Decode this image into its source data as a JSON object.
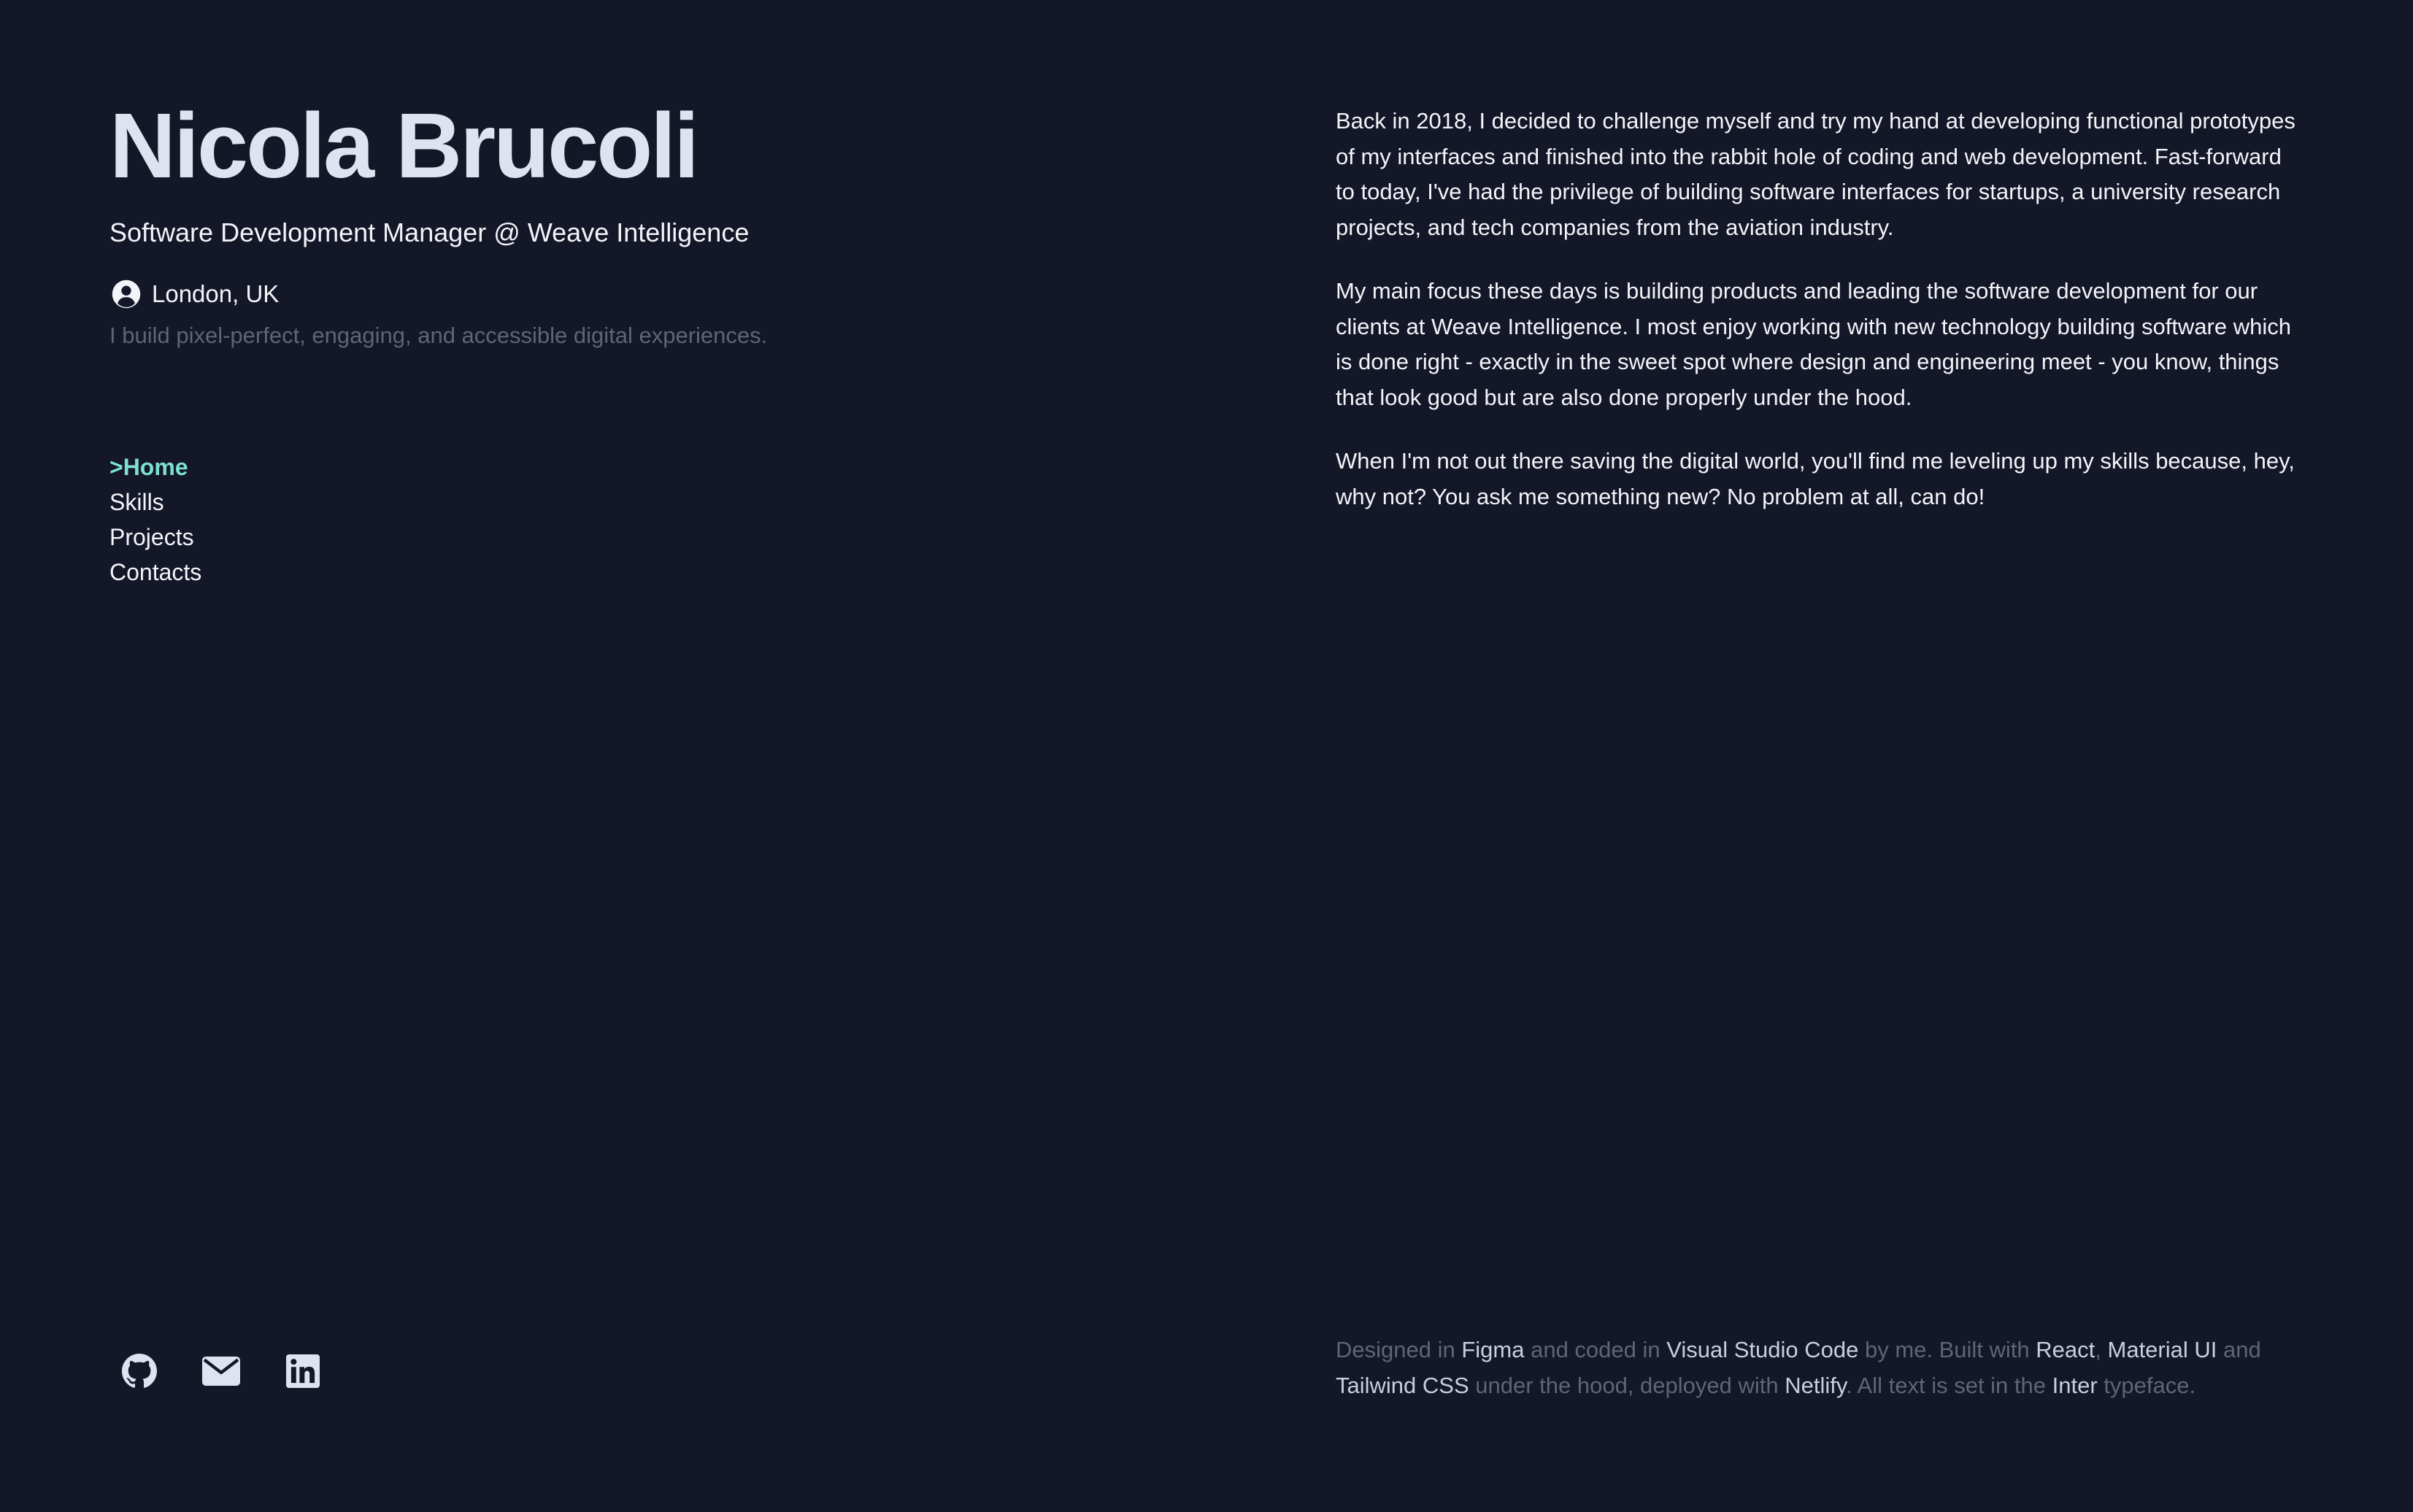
{
  "profile": {
    "name": "Nicola Brucoli",
    "role": "Software Development Manager @ Weave Intelligence",
    "location": "London, UK",
    "tagline": "I build pixel-perfect, engaging, and accessible digital experiences."
  },
  "nav": {
    "items": [
      {
        "label": ">Home",
        "active": true
      },
      {
        "label": "Skills",
        "active": false
      },
      {
        "label": "Projects",
        "active": false
      },
      {
        "label": "Contacts",
        "active": false
      }
    ]
  },
  "socials": {
    "icons": [
      "github-icon",
      "mail-icon",
      "linkedin-icon"
    ]
  },
  "about": {
    "paragraphs": [
      "Back in 2018, I decided to challenge myself and try my hand at developing functional prototypes of my interfaces and finished into the rabbit hole of coding and web development. Fast-forward to today, I've had the privilege of building software interfaces for startups, a university research projects, and tech companies from the aviation industry.",
      "My main focus these days is building products and leading the software development for our clients at Weave Intelligence. I most enjoy working with new technology building software which is done right - exactly in the sweet spot where design and engineering meet - you know, things that look good but are also done properly under the hood.",
      "When I'm not out there saving the digital world, you'll find me leveling up my skills because, hey, why not? You ask me something new? No problem at all, can do!"
    ]
  },
  "footer": {
    "t1": "Designed in ",
    "figma": "Figma",
    "t2": " and coded in ",
    "vscode": "Visual Studio Code",
    "t3": " by me. Built with ",
    "react": "React",
    "t4": ", ",
    "mui": "Material UI",
    "t5": " and ",
    "tailwind": "Tailwind CSS",
    "t6": " under the hood, deployed with ",
    "netlify": "Netlify",
    "t7": ". All text is set in the ",
    "inter": "Inter",
    "t8": " typeface."
  },
  "colors": {
    "background": "#131727",
    "accent": "#7de0d0",
    "muted": "#5f6577",
    "text": "#f2f4f8"
  }
}
